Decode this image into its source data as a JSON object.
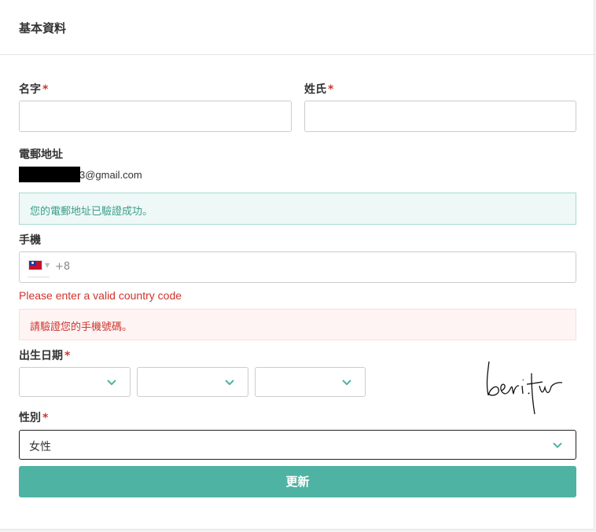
{
  "header": {
    "title": "基本資料"
  },
  "form": {
    "first_name": {
      "label": "名字",
      "required": "*",
      "value": ""
    },
    "last_name": {
      "label": "姓氏",
      "required": "*",
      "value": ""
    },
    "email": {
      "label": "電郵地址",
      "value_visible": "3@gmail.com",
      "verified_message": "您的電郵地址已驗證成功。"
    },
    "phone": {
      "label": "手機",
      "country_flag": "taiwan-flag-icon",
      "dial_prefix": "+8",
      "error": "Please enter a valid country code",
      "verify_message": "請驗證您的手機號碼。"
    },
    "birthday": {
      "label": "出生日期",
      "required": "*",
      "year": "",
      "month": "",
      "day": ""
    },
    "gender": {
      "label": "性別",
      "required": "*",
      "value": "女性"
    },
    "submit_label": "更新"
  },
  "colors": {
    "accent": "#4eb3a3",
    "error": "#d0342c",
    "success_text": "#3a9e8c"
  }
}
